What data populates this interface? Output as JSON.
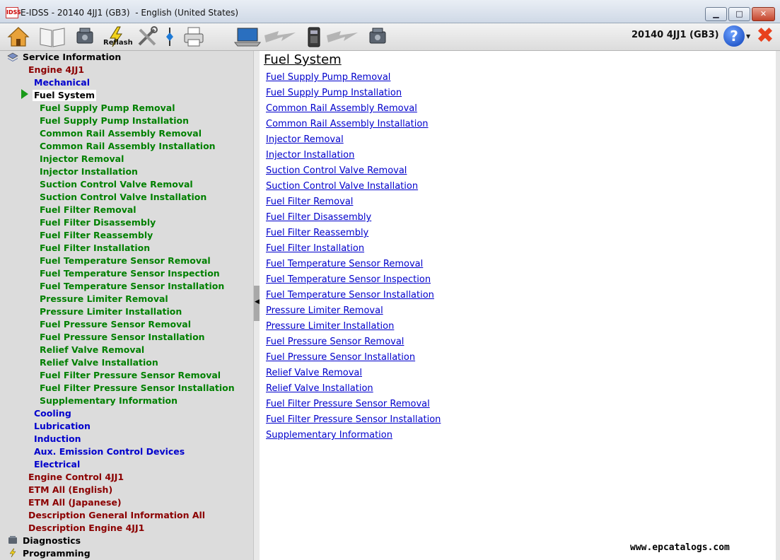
{
  "window": {
    "logo_text": "IDSS",
    "title": "E-IDSS - 20140 4JJ1 (GB3)  - English (United States)",
    "minimize_label": "▁",
    "maximize_label": "□",
    "close_label": "✕"
  },
  "toolbar": {
    "reflash_label": "Reflash",
    "vehicle": "20140 4JJ1 (GB3)",
    "help_label": "?",
    "help_dropdown": "▼",
    "exit_label": "✖",
    "icons": [
      "home-icon",
      "book-icon",
      "engine-icon",
      "reflash-icon",
      "tools-icon",
      "pin-icon",
      "printer-icon",
      "laptop-icon",
      "lightning-icon",
      "device-icon",
      "lightning-icon",
      "engine-icon"
    ]
  },
  "tree": {
    "root": "Service Information",
    "engine": "Engine 4JJ1",
    "mechanical": "Mechanical",
    "fuel_system": "Fuel System",
    "fuel_children": [
      "Fuel Supply Pump Removal",
      "Fuel Supply Pump Installation",
      "Common Rail Assembly Removal",
      "Common Rail Assembly Installation",
      "Injector Removal",
      "Injector Installation",
      "Suction Control Valve Removal",
      "Suction Control Valve Installation",
      "Fuel Filter Removal",
      "Fuel Filter Disassembly",
      "Fuel Filter Reassembly",
      "Fuel Filter Installation",
      "Fuel Temperature Sensor Removal",
      "Fuel Temperature Sensor Inspection",
      "Fuel Temperature Sensor Installation",
      "Pressure Limiter Removal",
      "Pressure Limiter Installation",
      "Fuel Pressure Sensor Removal",
      "Fuel Pressure Sensor Installation",
      "Relief Valve Removal",
      "Relief Valve Installation",
      "Fuel Filter Pressure Sensor Removal",
      "Fuel Filter Pressure Sensor Installation",
      "Supplementary Information"
    ],
    "engine_groups": [
      "Cooling",
      "Lubrication",
      "Induction",
      "Aux. Emission Control Devices",
      "Electrical"
    ],
    "top_sections": [
      "Engine Control 4JJ1",
      "ETM All (English)",
      "ETM All (Japanese)",
      "Description General Information All",
      "Description Engine 4JJ1"
    ],
    "diagnostics": "Diagnostics",
    "programming": "Programming"
  },
  "content": {
    "title": "Fuel System",
    "links": [
      "Fuel Supply Pump Removal",
      "Fuel Supply Pump Installation",
      "Common Rail Assembly Removal",
      "Common Rail Assembly Installation",
      "Injector Removal",
      "Injector Installation",
      "Suction Control Valve Removal",
      "Suction Control Valve Installation",
      "Fuel Filter Removal",
      "Fuel Filter Disassembly",
      "Fuel Filter Reassembly",
      "Fuel Filter Installation",
      "Fuel Temperature Sensor Removal",
      "Fuel Temperature Sensor Inspection",
      "Fuel Temperature Sensor Installation",
      "Pressure Limiter Removal",
      "Pressure Limiter Installation",
      "Fuel Pressure Sensor Removal",
      "Fuel Pressure Sensor Installation",
      "Relief Valve Removal",
      "Relief Valve Installation",
      "Fuel Filter Pressure Sensor Removal",
      "Fuel Filter Pressure Sensor Installation",
      "Supplementary Information"
    ],
    "watermark": "www.epcatalogs.com"
  },
  "splitter": {
    "arrow": "◀"
  }
}
